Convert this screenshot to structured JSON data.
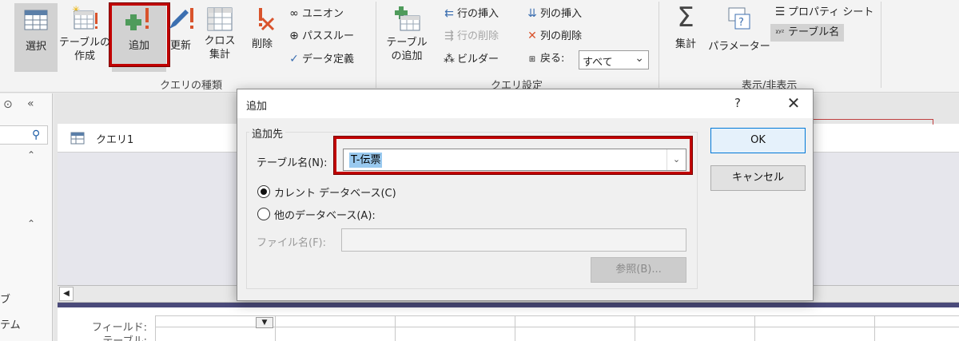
{
  "ribbon": {
    "query_type": {
      "select": "選択",
      "make_table_1": "テーブルの",
      "make_table_2": "作成",
      "append": "追加",
      "update": "更新",
      "crosstab_1": "クロス",
      "crosstab_2": "集計",
      "delete": "削除",
      "union": "ユニオン",
      "passthrough": "パススルー",
      "data_definition": "データ定義",
      "group_label": "クエリの種類"
    },
    "query_setup": {
      "show_table_1": "テーブル",
      "show_table_2": "の追加",
      "insert_rows": "行の挿入",
      "delete_rows": "行の削除",
      "builder": "ビルダー",
      "insert_columns": "列の挿入",
      "delete_columns": "列の削除",
      "return_label": "戻る:",
      "return_value": "すべて",
      "group_label": "クエリ設定"
    },
    "show_hide": {
      "totals": "集計",
      "parameters": "パラメーター",
      "property_sheet": "プロパティ シート",
      "table_names": "テーブル名",
      "group_label": "表示/非表示"
    }
  },
  "nav": {
    "item_1": "ブ",
    "item_2": "テム"
  },
  "query_tab": {
    "title": "クエリ1"
  },
  "grid": {
    "field_label": "フィールド:",
    "table_label": "テーブル:"
  },
  "dialog": {
    "title": "追加",
    "help": "?",
    "group_label": "追加先",
    "table_name_label": "テーブル名(N):",
    "table_name_value": "T-伝票",
    "current_db": "カレント データベース(C)",
    "other_db": "他のデータベース(A):",
    "file_name_label": "ファイル名(F):",
    "file_name_value": "",
    "browse": "参照(B)...",
    "ok": "OK",
    "cancel": "キャンセル"
  },
  "colors": {
    "highlight_red": "#c00000",
    "selection_blue": "#99c9ef",
    "splitter": "#4a4a7a"
  }
}
